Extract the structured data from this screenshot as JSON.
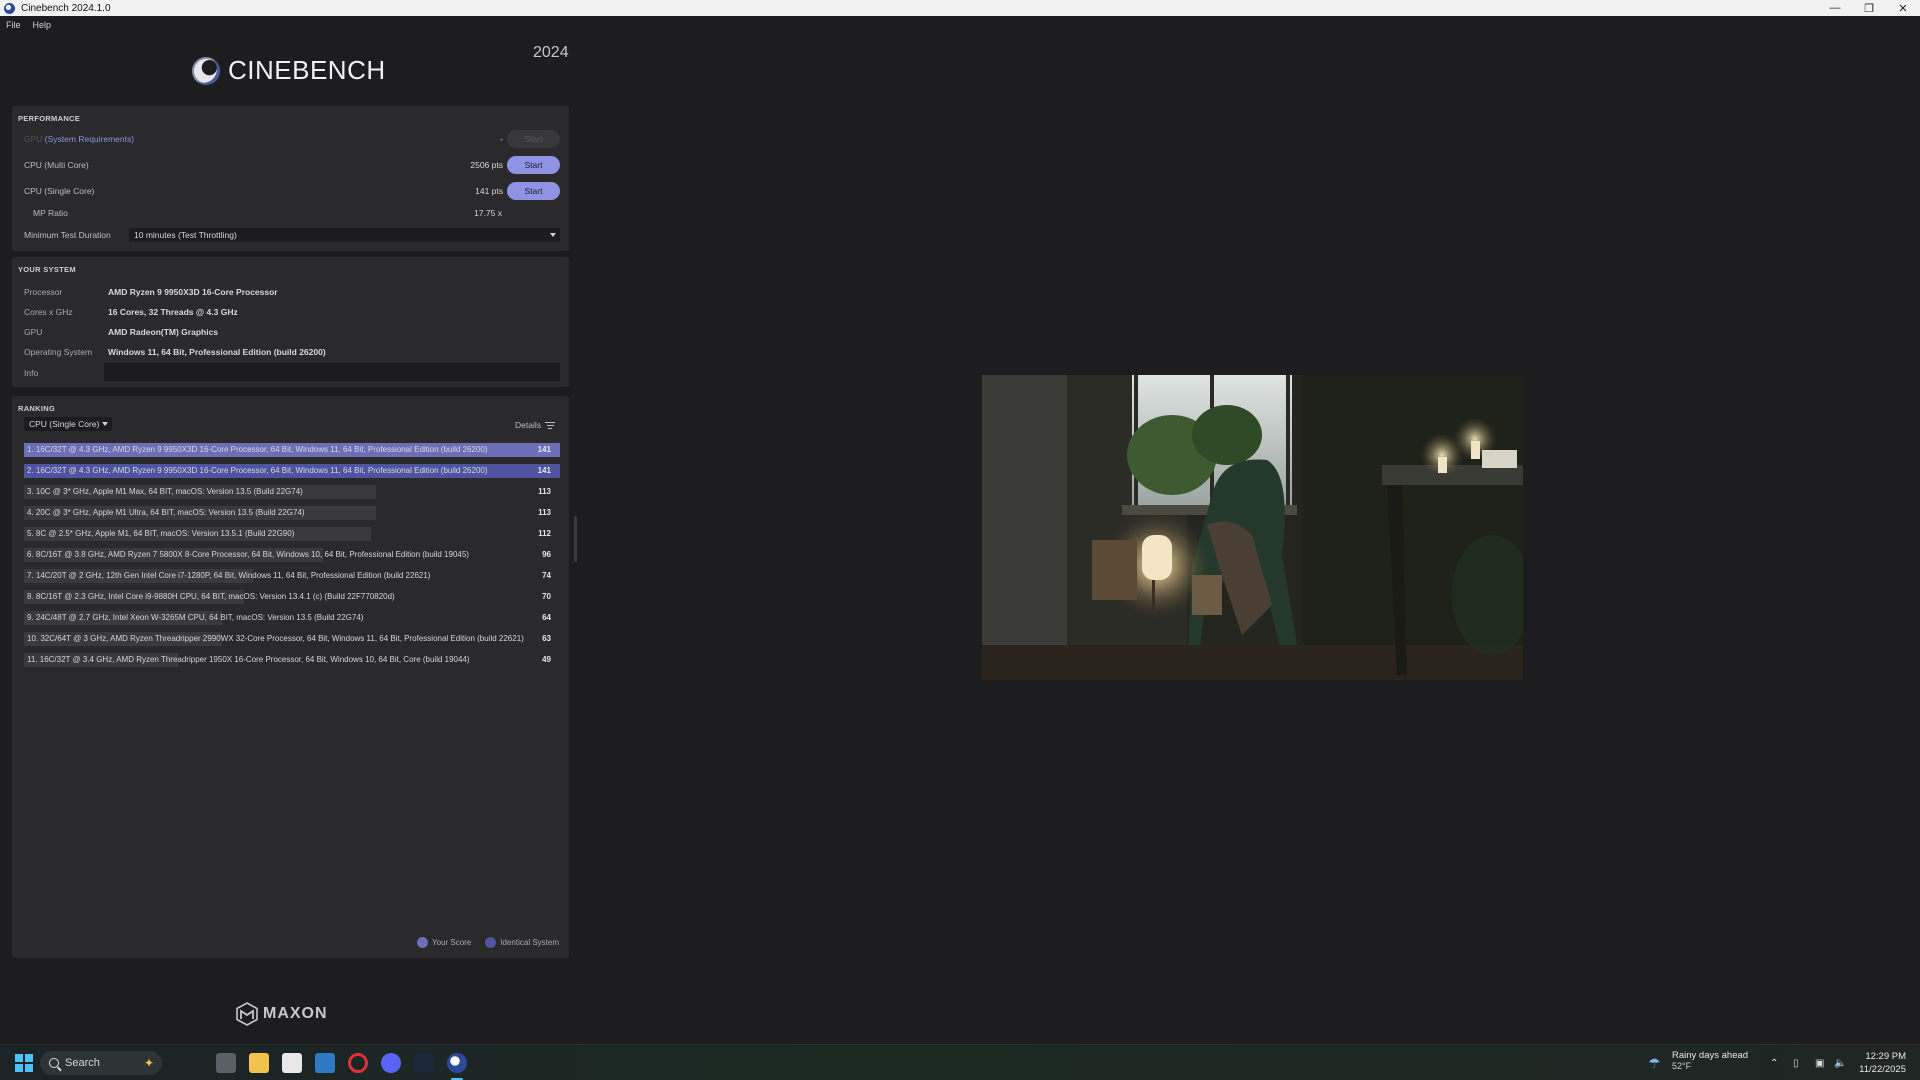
{
  "window": {
    "title": "Cinebench 2024.1.0"
  },
  "menu": [
    "File",
    "Help"
  ],
  "app": {
    "logo_text": "CINEBENCH",
    "year": "2024"
  },
  "performance": {
    "title": "PERFORMANCE",
    "gpu": {
      "prefix": "GPU",
      "link": "(System Requirements)",
      "value": "-",
      "button": "Start"
    },
    "multi": {
      "label": "CPU (Multi Core)",
      "value": "2506 pts",
      "button": "Start"
    },
    "single": {
      "label": "CPU (Single Core)",
      "value": "141 pts",
      "button": "Start"
    },
    "mp_ratio": {
      "label": "MP Ratio",
      "value": "17.75 x"
    },
    "duration": {
      "label": "Minimum Test Duration",
      "selected": "10 minutes (Test Throttling)"
    }
  },
  "your_system": {
    "title": "YOUR SYSTEM",
    "rows": [
      {
        "label": "Processor",
        "value": "AMD Ryzen 9 9950X3D 16-Core Processor"
      },
      {
        "label": "Cores x GHz",
        "value": "16 Cores, 32 Threads @ 4.3 GHz"
      },
      {
        "label": "GPU",
        "value": "AMD Radeon(TM) Graphics"
      },
      {
        "label": "Operating System",
        "value": "Windows 11, 64 Bit, Professional Edition (build 26200)"
      },
      {
        "label": "Info",
        "value": ""
      }
    ]
  },
  "ranking": {
    "title": "RANKING",
    "selected": "CPU (Single Core)",
    "details_label": "Details",
    "rows": [
      {
        "text": "1. 16C/32T @ 4.3 GHz, AMD Ryzen 9 9950X3D 16-Core Processor, 64 Bit, Windows 11, 64 Bit, Professional Edition (build 26200)",
        "score": "141",
        "kind": "you",
        "fill": 1.0
      },
      {
        "text": "2. 16C/32T @ 4.3 GHz, AMD Ryzen 9 9950X3D 16-Core Processor, 64 Bit, Windows 11, 64 Bit, Professional Edition (build 26200)",
        "score": "141",
        "kind": "ident",
        "fill": 1.0
      },
      {
        "text": "3. 10C @ 3* GHz, Apple M1 Max, 64 BIT, macOS: Version 13.5 (Build 22G74)",
        "score": "113",
        "kind": "other",
        "fill": 0.8
      },
      {
        "text": "4. 20C @ 3* GHz, Apple M1 Ultra, 64 BIT, macOS: Version 13.5 (Build 22G74)",
        "score": "113",
        "kind": "other",
        "fill": 0.8
      },
      {
        "text": "5. 8C @ 2.5* GHz, Apple M1, 64 BIT, macOS: Version 13.5.1 (Build 22G90)",
        "score": "112",
        "kind": "other",
        "fill": 0.79
      },
      {
        "text": "6. 8C/16T @ 3.8 GHz, AMD Ryzen 7 5800X 8-Core Processor, 64 Bit, Windows 10, 64 Bit, Professional Edition (build 19045)",
        "score": "96",
        "kind": "other",
        "fill": 0.68
      },
      {
        "text": "7. 14C/20T @ 2 GHz, 12th Gen Intel Core i7-1280P, 64 Bit, Windows 11, 64 Bit, Professional Edition (build 22621)",
        "score": "74",
        "kind": "other",
        "fill": 0.52
      },
      {
        "text": "8. 8C/16T @ 2.3 GHz, Intel Core i9-9880H CPU, 64 BIT, macOS: Version 13.4.1 (c) (Build 22F770820d)",
        "score": "70",
        "kind": "other",
        "fill": 0.5
      },
      {
        "text": "9. 24C/48T @ 2.7 GHz, Intel Xeon W-3265M CPU, 64 BIT, macOS: Version 13.5 (Build 22G74)",
        "score": "64",
        "kind": "other",
        "fill": 0.45
      },
      {
        "text": "10. 32C/64T @ 3 GHz, AMD Ryzen Threadripper 2990WX 32-Core Processor, 64 Bit, Windows 11, 64 Bit, Professional Edition (build 22621)",
        "score": "63",
        "kind": "other",
        "fill": 0.45
      },
      {
        "text": "11. 16C/32T @ 3.4 GHz, AMD Ryzen Threadripper 1950X 16-Core Processor, 64 Bit, Windows 10, 64 Bit, Core (build 19044)",
        "score": "49",
        "kind": "other",
        "fill": 0.35
      }
    ],
    "legend": {
      "your_score": "Your Score",
      "identical": "Identical System",
      "your_color": "#6c6fb8",
      "identical_color": "#5054a0"
    }
  },
  "footer": {
    "brand": "MAXON"
  },
  "taskbar": {
    "search": "Search",
    "weather_line1": "Rainy days ahead",
    "weather_line2": "52°F",
    "time": "12:29 PM",
    "date": "11/22/2025"
  },
  "colors": {
    "accent": "#8f93e3",
    "background": "#1d1d1f",
    "panel": "#2a2a2d"
  }
}
